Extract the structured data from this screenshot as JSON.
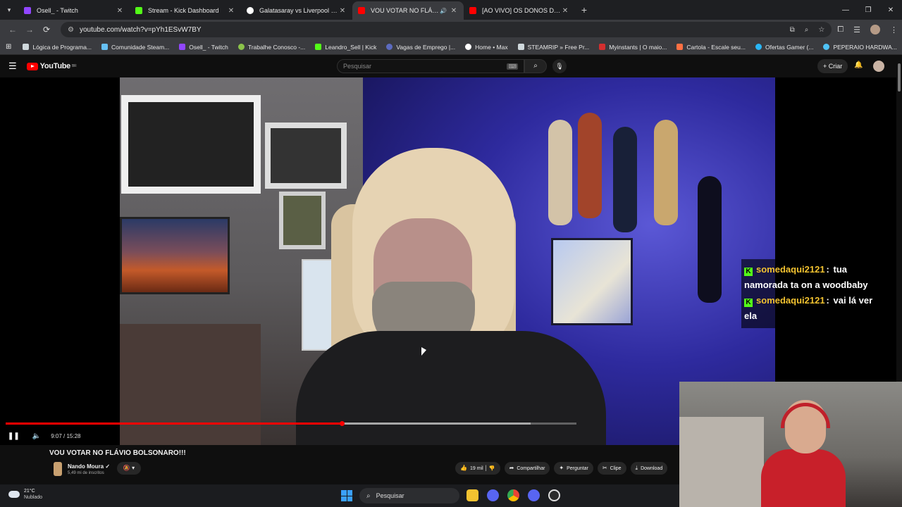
{
  "browser": {
    "tabs": [
      {
        "title": "Osell_ - Twitch",
        "color": "#9146ff",
        "active": false
      },
      {
        "title": "Stream - Kick Dashboard",
        "color": "#53fc18",
        "active": false
      },
      {
        "title": "Galatasaray vs Liverpool • HBO",
        "color": "#ffffff",
        "active": false
      },
      {
        "title": "VOU VOTAR NO FLÁVIO BO",
        "color": "#ff0000",
        "active": true
      },
      {
        "title": "[AO VIVO] OS DONOS DA BOL",
        "color": "#ff0000",
        "active": false
      }
    ],
    "url": "youtube.com/watch?v=pYh1ESvW7BY",
    "bookmarks": [
      {
        "label": "Lógica de Programa...",
        "color": "#cfd8dc"
      },
      {
        "label": "Comunidade Steam...",
        "color": "#66c0f4"
      },
      {
        "label": "Osell_ - Twitch",
        "color": "#9146ff"
      },
      {
        "label": "Trabalhe Conosco -...",
        "color": "#8bc34a"
      },
      {
        "label": "Leandro_Sell | Kick",
        "color": "#53fc18"
      },
      {
        "label": "Vagas de Emprego |...",
        "color": "#5c6bc0"
      },
      {
        "label": "Home • Max",
        "color": "#ffffff"
      },
      {
        "label": "STEAMRIP » Free Pr...",
        "color": "#cfd8dc"
      },
      {
        "label": "Myinstants | O maio...",
        "color": "#d32f2f"
      },
      {
        "label": "Cartola - Escale seu...",
        "color": "#ff7043"
      },
      {
        "label": "Ofertas Gamer (...",
        "color": "#29b6f6"
      },
      {
        "label": "PEPERAIO HARDWA...",
        "color": "#4fc3f7"
      }
    ]
  },
  "youtube": {
    "logo_text": "YouTube",
    "region": "BR",
    "search_placeholder": "Pesquisar",
    "create_label": "Criar",
    "video": {
      "title": "VOU VOTAR NO FLÁVIO BOLSONARO!!!",
      "time": "9:07 / 15:28",
      "progress": 0.589,
      "buffered": 0.92
    },
    "channel": {
      "name": "Nando Moura",
      "subscribers": "5,49 mi de inscritos"
    },
    "actions": {
      "likes": "19 mil",
      "share": "Compartilhar",
      "ask": "Perguntar",
      "clip": "Clipe",
      "download": "Download"
    }
  },
  "chat_overlay": [
    {
      "user": "somedaqui2121",
      "message": "tua namorada ta on a woodbaby"
    },
    {
      "user": "somedaqui2121",
      "message": "vai lá ver ela"
    }
  ],
  "taskbar": {
    "temperature": "21°C",
    "condition": "Nublado",
    "search_label": "Pesquisar"
  }
}
